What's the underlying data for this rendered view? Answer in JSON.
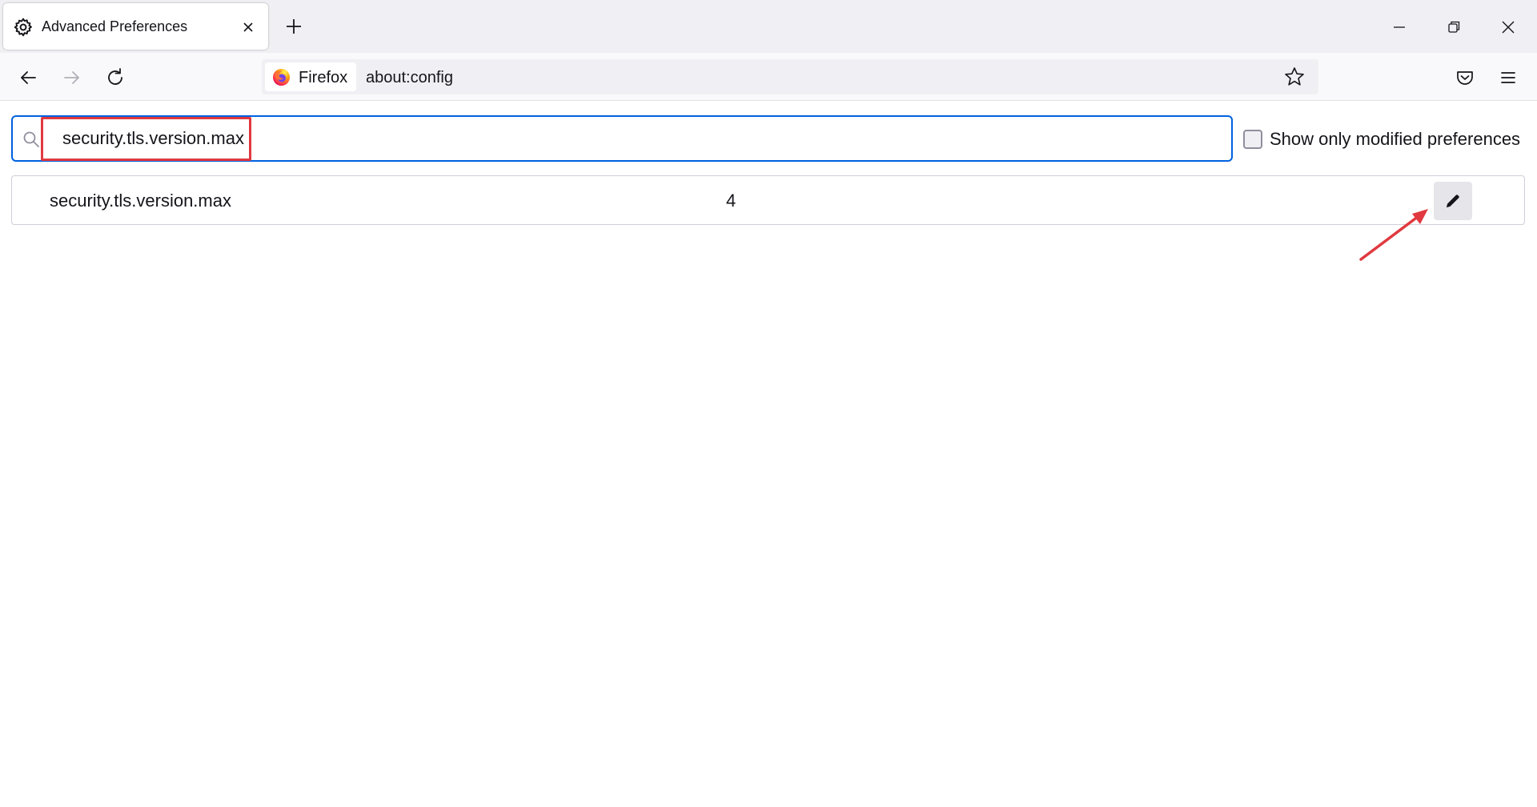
{
  "tab": {
    "title": "Advanced Preferences",
    "icon": "gear-icon"
  },
  "window_controls": [
    "minimize-icon",
    "restore-icon",
    "close-icon"
  ],
  "navbar": {
    "identity_label": "Firefox",
    "url": "about:config"
  },
  "search": {
    "value": "security.tls.version.max",
    "highlight_color": "#e0393f"
  },
  "filter": {
    "label": "Show only modified preferences",
    "checked": false
  },
  "preferences": [
    {
      "name": "security.tls.version.max",
      "value": "4"
    }
  ],
  "colors": {
    "accent": "#0061e0",
    "annotation": "#e0393f"
  }
}
